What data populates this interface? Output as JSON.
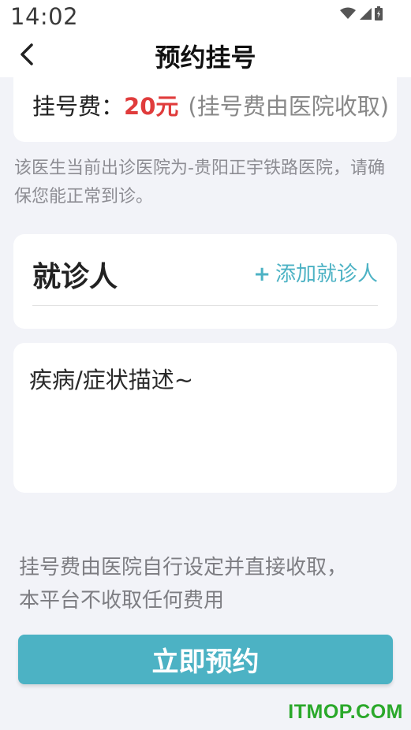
{
  "status_bar": {
    "time": "14:02",
    "icons": [
      "wifi-icon",
      "signal-icon",
      "battery-icon"
    ]
  },
  "nav": {
    "title": "预约挂号",
    "back_icon": "chevron-left-icon"
  },
  "fee": {
    "label": "挂号费：",
    "amount": "20元",
    "note": "(挂号费由医院收取)"
  },
  "notice": "该医生当前出诊医院为-贵阳正宇铁路医院，请确保您能正常到诊。",
  "patient": {
    "title": "就诊人",
    "add_plus": "+",
    "add_label": "添加就诊人"
  },
  "symptom": {
    "placeholder": "疾病/症状描述~",
    "value": ""
  },
  "disclaimer": {
    "line1": "挂号费由医院自行设定并直接收取，",
    "line2": "本平台不收取任何费用"
  },
  "book_button": {
    "label": "立即预约"
  },
  "watermark": "ITMOP.COM",
  "colors": {
    "accent": "#4cb2c4",
    "fee_amount": "#e03c3c",
    "background": "#f2f3f8",
    "watermark": "#2aa82a"
  }
}
